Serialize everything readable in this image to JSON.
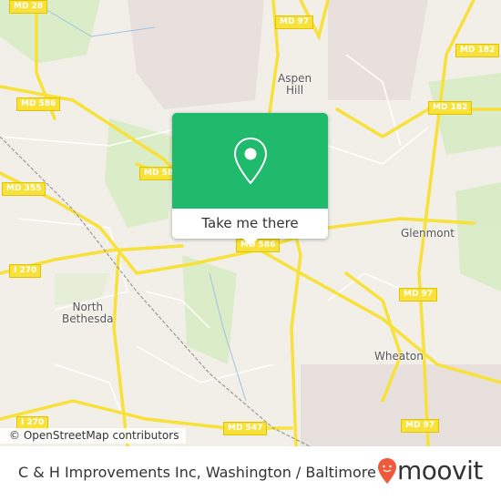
{
  "map": {
    "road_labels": [
      "MD 28",
      "MD 97",
      "MD 182",
      "MD 586",
      "MD 182",
      "MD 58",
      "MD 355",
      "MD 586",
      "MD 97",
      "I 270",
      "I 270",
      "MD 547",
      "MD 97"
    ],
    "places": [
      "Aspen\nHill",
      "Glenmont",
      "North\nBethesda",
      "Wheaton"
    ],
    "attribution": "© OpenStreetMap contributors",
    "colors": {
      "land": "#f2efe9",
      "road": "#f7e13a",
      "park": "#d8ecc4",
      "popup": "#1fba6b"
    }
  },
  "popup": {
    "icon": "map-pin-icon",
    "button_label": "Take me there"
  },
  "footer": {
    "title": "C & H Improvements Inc, Washington / Baltimore",
    "logo_text": "moovit",
    "logo_color": "#f05a3c"
  }
}
